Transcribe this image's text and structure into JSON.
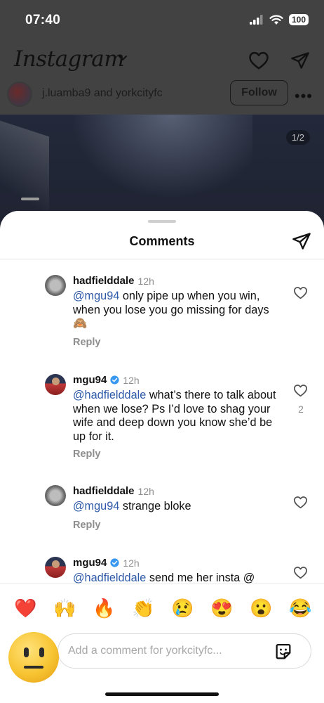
{
  "status_bar": {
    "time": "07:40",
    "battery": "100"
  },
  "header": {
    "logo": "Instagram"
  },
  "post": {
    "authors": "j.luamba9 and yorkcityfc",
    "follow_label": "Follow",
    "more_label": "•••",
    "page_indicator": "1/2"
  },
  "comments_sheet": {
    "title": "Comments",
    "comments": [
      {
        "user": "hadfielddale",
        "verified": false,
        "time": "12h",
        "mention": "@mgu94",
        "text": " only pipe up when you win, when you lose you go missing for days 🙈",
        "reply_label": "Reply",
        "like_count": ""
      },
      {
        "user": "mgu94",
        "verified": true,
        "time": "12h",
        "mention": "@hadfielddale",
        "text": " what’s there to talk about when we lose? Ps I’d love to shag your wife and deep down you know she’d be up for it.",
        "reply_label": "Reply",
        "like_count": "2"
      },
      {
        "user": "hadfielddale",
        "verified": false,
        "time": "12h",
        "mention": "@mgu94",
        "text": " strange bloke",
        "reply_label": "Reply",
        "like_count": ""
      },
      {
        "user": "mgu94",
        "verified": true,
        "time": "12h",
        "mention": "@hadfielddale",
        "text": " send me her insta @",
        "reply_label": "",
        "like_count": ""
      }
    ]
  },
  "reactions": [
    "❤️",
    "🙌",
    "🔥",
    "👏",
    "😢",
    "😍",
    "😮",
    "😂"
  ],
  "comment_input": {
    "placeholder": "Add a comment for yorkcityfc..."
  },
  "colors": {
    "mention": "#2f5aa8",
    "verified": "#3897f0",
    "muted": "#8e8e8e"
  },
  "icons": [
    "chevron-down-icon",
    "heart-icon",
    "send-icon",
    "more-icon",
    "verified-badge-icon",
    "sticker-icon"
  ]
}
